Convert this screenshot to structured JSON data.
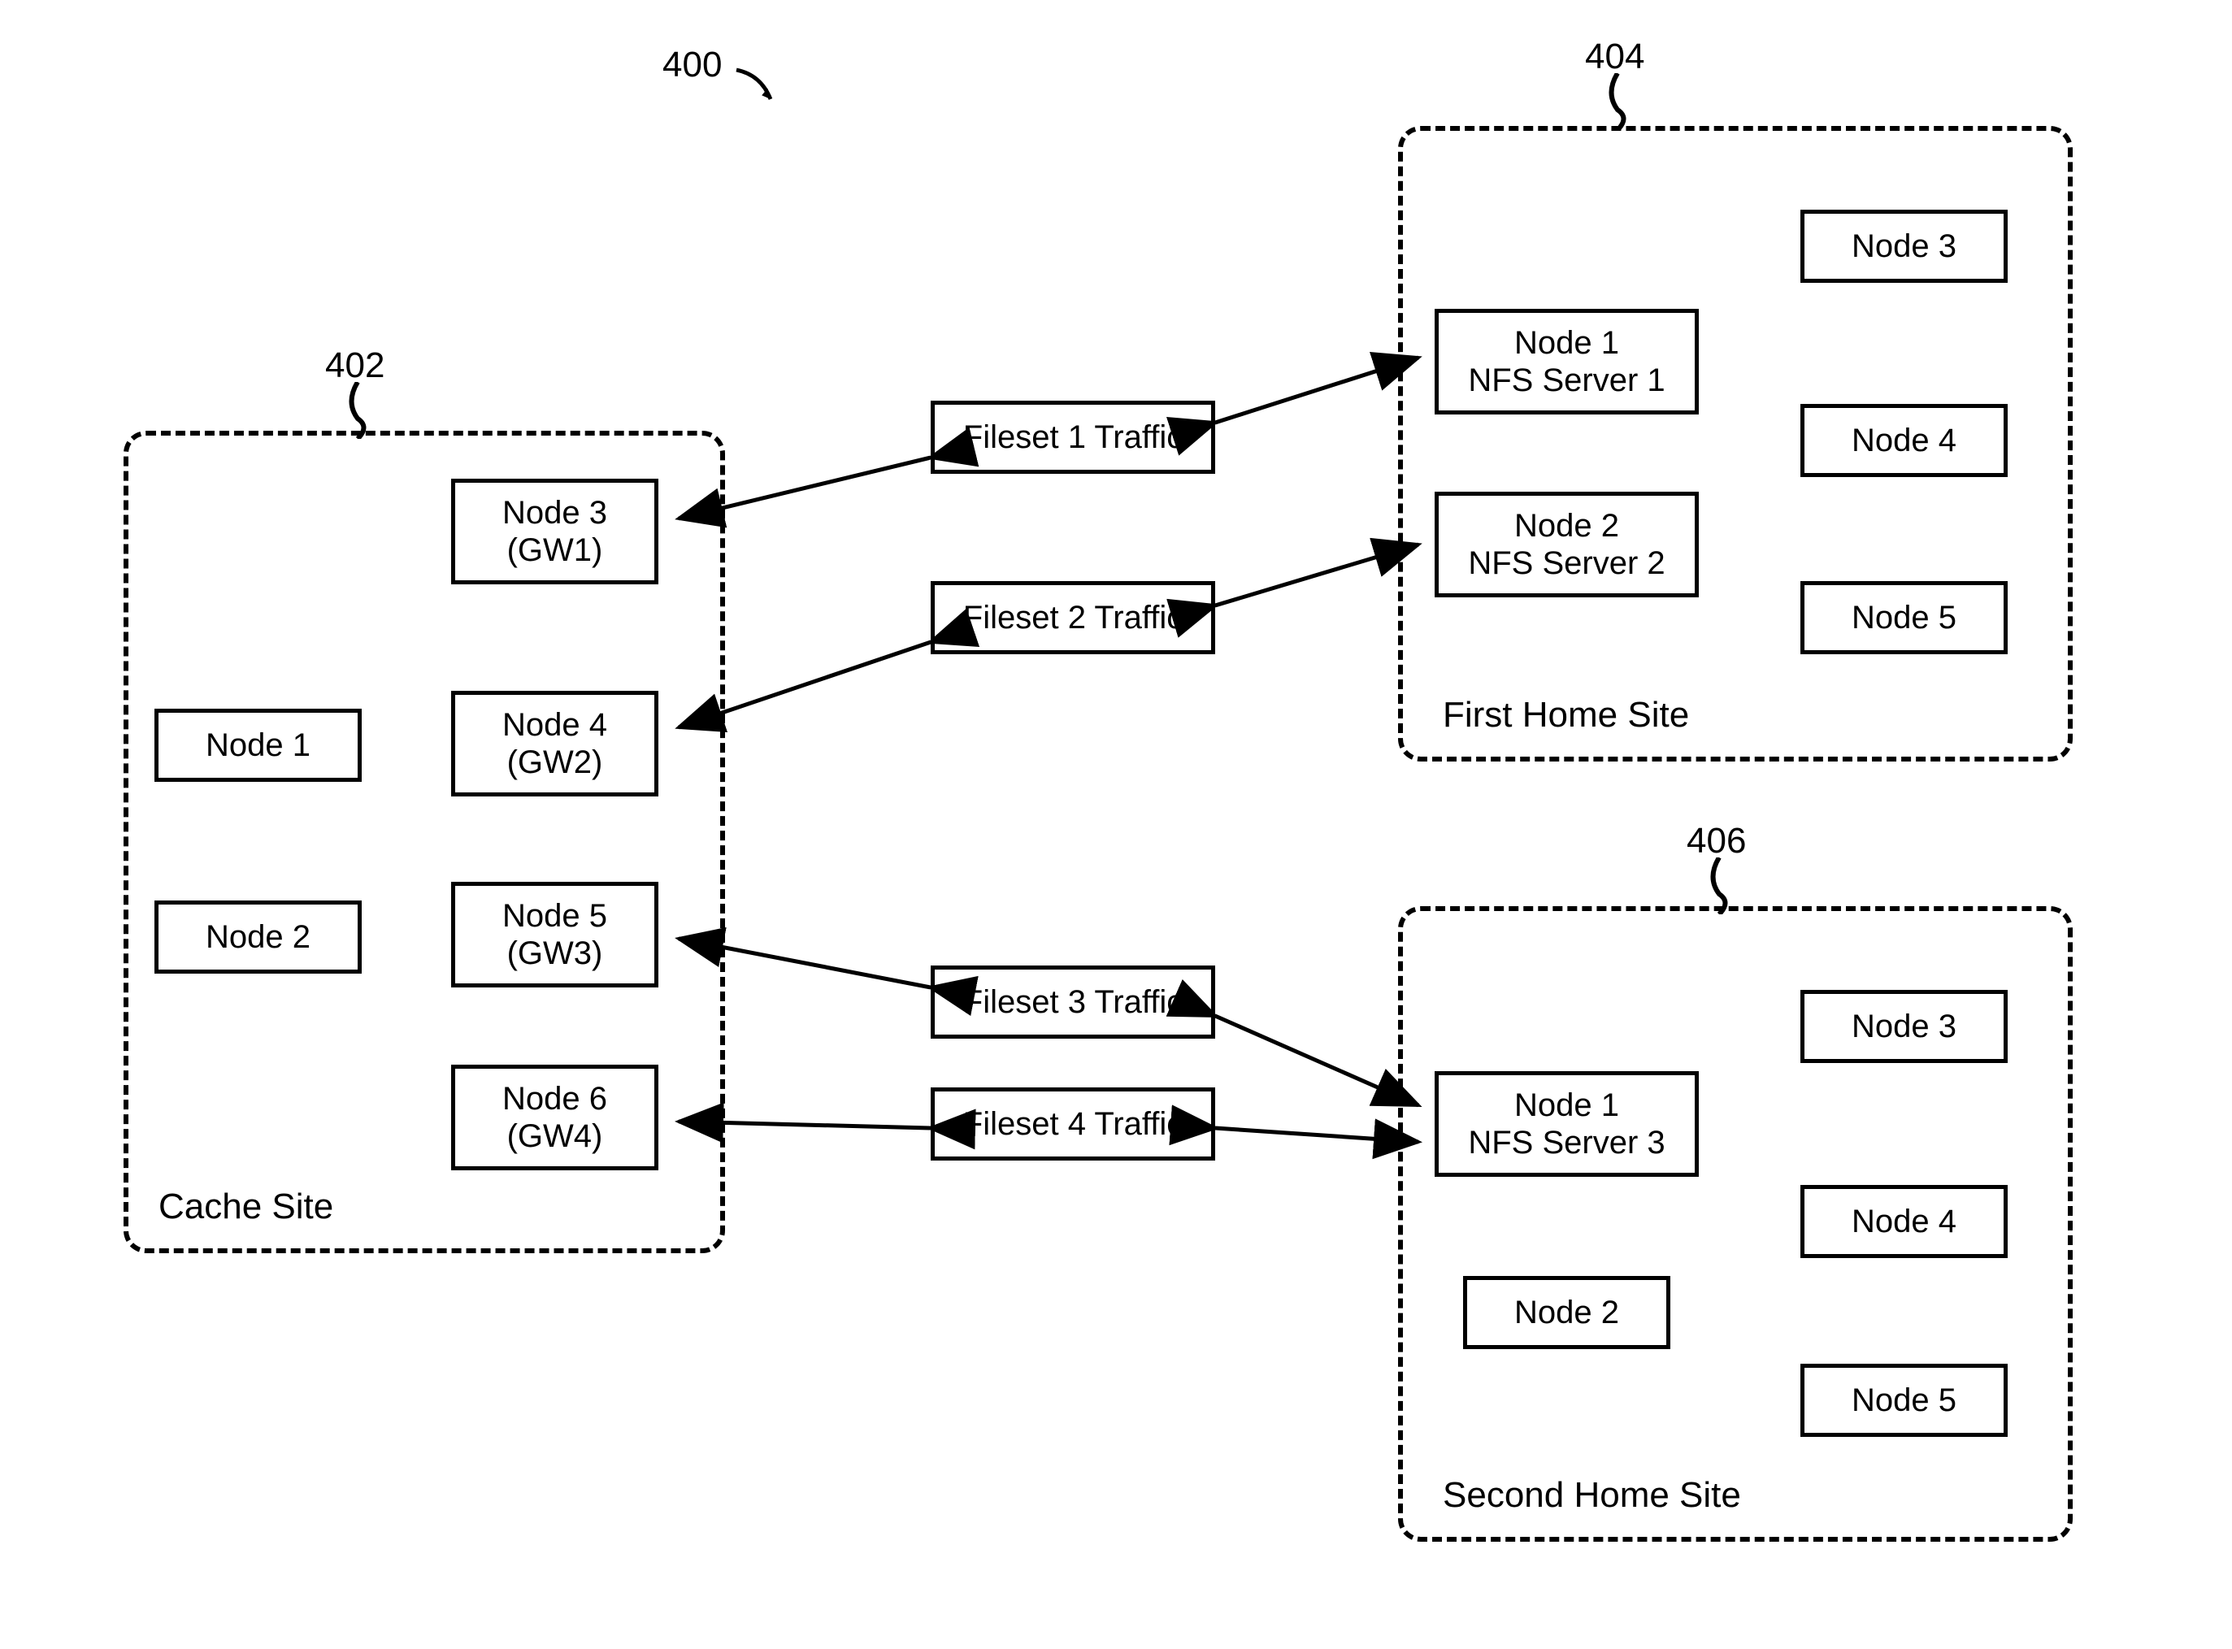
{
  "refs": {
    "r400": "400",
    "r402": "402",
    "r404": "404",
    "r406": "406"
  },
  "cache": {
    "site_label": "Cache Site",
    "node1": "Node 1",
    "node2": "Node 2",
    "node3_line1": "Node 3",
    "node3_line2": "(GW1)",
    "node4_line1": "Node 4",
    "node4_line2": "(GW2)",
    "node5_line1": "Node 5",
    "node5_line2": "(GW3)",
    "node6_line1": "Node 6",
    "node6_line2": "(GW4)"
  },
  "home1": {
    "site_label": "First Home Site",
    "node1_line1": "Node 1",
    "node1_line2": "NFS Server 1",
    "node2_line1": "Node 2",
    "node2_line2": "NFS Server 2",
    "node3": "Node 3",
    "node4": "Node 4",
    "node5": "Node 5"
  },
  "home2": {
    "site_label": "Second Home Site",
    "node1_line1": "Node 1",
    "node1_line2": "NFS Server 3",
    "node2": "Node 2",
    "node3": "Node 3",
    "node4": "Node 4",
    "node5": "Node 5"
  },
  "traffic": {
    "f1": "Fileset 1 Traffic",
    "f2": "Fileset 2 Traffic",
    "f3": "Fileset 3 Traffic",
    "f4": "Fileset 4 Traffic"
  }
}
